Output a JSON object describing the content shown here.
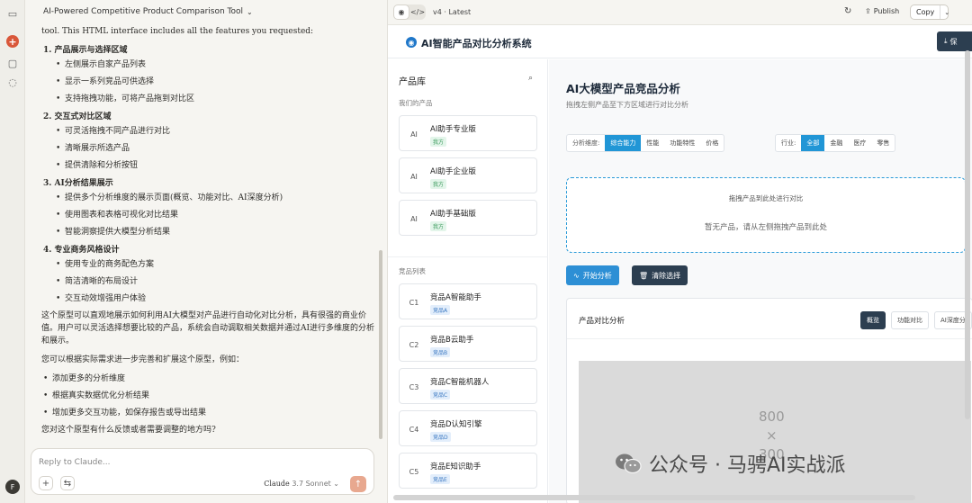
{
  "chat": {
    "title": "AI-Powered Competitive Product Comparison Tool",
    "intro": "tool. This HTML interface includes all the features you requested:",
    "sections": [
      {
        "heading": "1. 产品展示与选择区域",
        "items": [
          "左侧展示自家产品列表",
          "显示一系列竞品可供选择",
          "支持拖拽功能，可将产品拖到对比区"
        ]
      },
      {
        "heading": "2. 交互式对比区域",
        "items": [
          "可灵活拖拽不同产品进行对比",
          "清晰展示所选产品",
          "提供清除和分析按钮"
        ]
      },
      {
        "heading": "3. AI分析结果展示",
        "items": [
          "提供多个分析维度的展示页面(概览、功能对比、AI深度分析)",
          "使用图表和表格可视化对比结果",
          "智能洞察提供大模型分析结果"
        ]
      },
      {
        "heading": "4. 专业商务风格设计",
        "items": [
          "使用专业的商务配色方案",
          "简洁清晰的布局设计",
          "交互动效增强用户体验"
        ]
      }
    ],
    "para1": "这个原型可以直观地展示如何利用AI大模型对产品进行自动化对比分析，具有很强的商业价值。用户可以灵活选择想要比较的产品，系统会自动调取相关数据并通过AI进行多维度的分析和展示。",
    "para2": "您可以根据实际需求进一步完善和扩展这个原型，例如：",
    "extras": [
      "添加更多的分析维度",
      "根据真实数据优化分析结果",
      "增加更多交互功能，如保存报告或导出结果"
    ],
    "para3": "您对这个原型有什么反馈或者需要调整的地方吗?",
    "composer_placeholder": "Reply to Claude...",
    "model_name": "Claude",
    "model_version": "3.7 Sonnet"
  },
  "rail": {
    "avatar": "F"
  },
  "artifact": {
    "version": "v4 · Latest",
    "publish_label": "Publish",
    "copy_label": "Copy"
  },
  "app": {
    "title": "AI智能产品对比分析系统",
    "save_label": "保",
    "library": {
      "heading": "产品库",
      "own_group": "我们的产品",
      "own_products": [
        {
          "avatar": "AI",
          "name": "AI助手专业版",
          "tag": "我方"
        },
        {
          "avatar": "AI",
          "name": "AI助手企业版",
          "tag": "我方"
        },
        {
          "avatar": "AI",
          "name": "AI助手基础版",
          "tag": "我方"
        }
      ],
      "comp_group": "竞品列表",
      "competitors": [
        {
          "avatar": "C1",
          "name": "竞品A智能助手",
          "tag": "竞品A"
        },
        {
          "avatar": "C2",
          "name": "竞品B云助手",
          "tag": "竞品B"
        },
        {
          "avatar": "C3",
          "name": "竞品C智能机器人",
          "tag": "竞品C"
        },
        {
          "avatar": "C4",
          "name": "竞品D认知引擎",
          "tag": "竞品D"
        },
        {
          "avatar": "C5",
          "name": "竞品E知识助手",
          "tag": "竞品E"
        }
      ]
    },
    "main": {
      "title": "AI大模型产品竞品分析",
      "subtitle": "拖拽左侧产品至下方区域进行对比分析",
      "dimension_label": "分析维度:",
      "dimensions": [
        "综合能力",
        "性能",
        "功能特性",
        "价格"
      ],
      "industry_label": "行业:",
      "industries": [
        "全部",
        "金融",
        "医疗",
        "零售"
      ],
      "drop_hint": "拖拽产品到此处进行对比",
      "drop_empty": "暂无产品，请从左侧拖拽产品到此处",
      "start_label": "开始分析",
      "clear_label": "清除选择",
      "panel_title": "产品对比分析",
      "panel_tabs": [
        "概览",
        "功能对比",
        "AI深度分"
      ],
      "placeholder_w": "800",
      "placeholder_x": "×",
      "placeholder_h": "300"
    }
  },
  "watermark": {
    "text": "公众号 · 马骋AI实战派"
  }
}
